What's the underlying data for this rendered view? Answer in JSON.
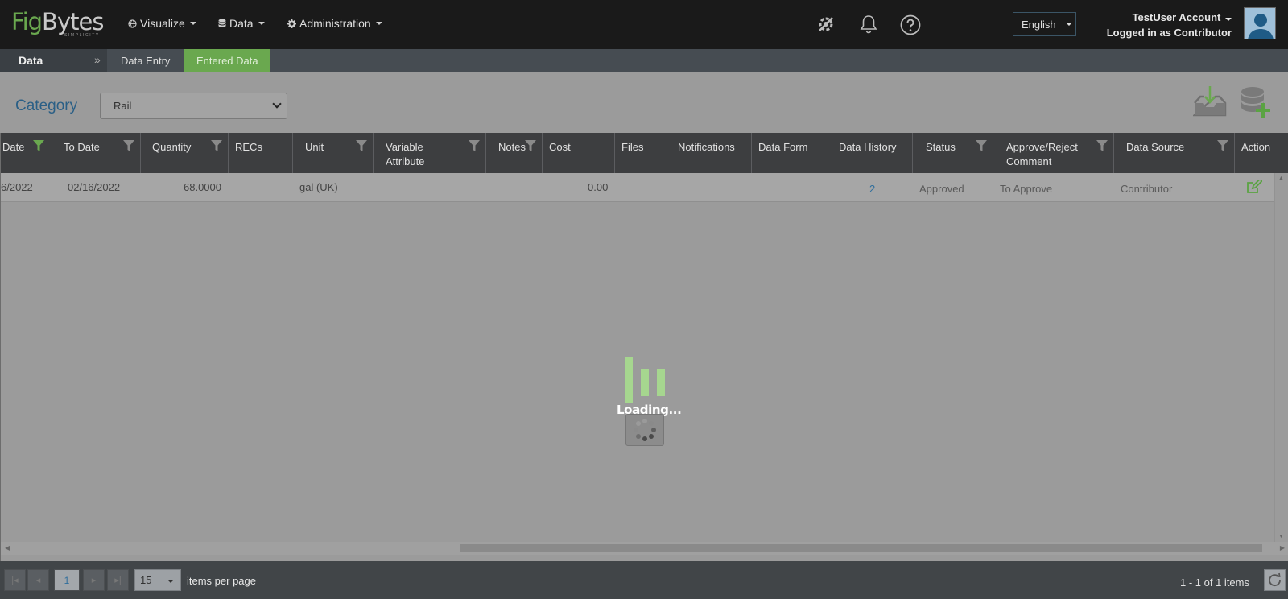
{
  "app": {
    "logo_main_a": "Fig",
    "logo_main_b": "Bytes",
    "logo_tagline": "SIMPLICITY"
  },
  "nav": {
    "visualize": "Visualize",
    "data": "Data",
    "administration": "Administration"
  },
  "header": {
    "language": "English",
    "account_name": "TestUser Account",
    "role_text": "Logged in as Contributor",
    "icons": [
      "settings-tools-icon",
      "bell-icon",
      "help-icon",
      "user-avatar"
    ]
  },
  "subnav": {
    "section": "Data",
    "tabs": [
      {
        "label": "Data Entry",
        "active": false
      },
      {
        "label": "Entered Data",
        "active": true
      }
    ]
  },
  "filters": {
    "category_label": "Category",
    "category_value": "Rail"
  },
  "grid": {
    "columns": [
      "Date",
      "To Date",
      "Quantity",
      "RECs",
      "Unit",
      "Variable Attribute",
      "Notes",
      "Cost",
      "Files",
      "Notifications",
      "Data Form",
      "Data History",
      "Status",
      "Approve/Reject Comment",
      "Data Source",
      "Action"
    ],
    "rows": [
      {
        "date": "6/2022",
        "to_date": "02/16/2022",
        "quantity": "68.0000",
        "recs": "",
        "unit": "gal (UK)",
        "variable_attribute": "",
        "notes": "",
        "cost": "0.00",
        "files": "",
        "notifications": "",
        "data_form": "",
        "data_history": "2",
        "status": "Approved",
        "comment": "To Approve",
        "data_source": "Contributor"
      }
    ]
  },
  "loading": {
    "text": "Loading..."
  },
  "pager": {
    "current_page": "1",
    "page_size": "15",
    "items_per_page_label": "items per page",
    "info": "1 - 1 of 1 items"
  },
  "colors": {
    "brand_green": "#6aa84f",
    "link_blue": "#2f6e9c",
    "header_bg": "#1a1a1a"
  }
}
